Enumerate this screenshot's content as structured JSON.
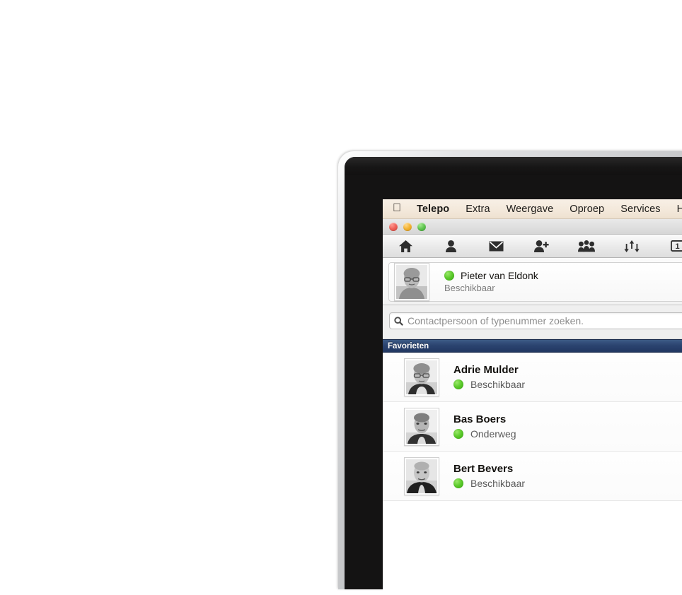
{
  "menubar": {
    "apple_icon": "apple-logo-icon",
    "items": [
      {
        "label": "Telepo",
        "bold": true
      },
      {
        "label": "Extra",
        "bold": false
      },
      {
        "label": "Weergave",
        "bold": false
      },
      {
        "label": "Oproep",
        "bold": false
      },
      {
        "label": "Services",
        "bold": false
      },
      {
        "label": "H",
        "bold": false
      }
    ]
  },
  "window": {
    "traffic_lights": [
      {
        "name": "close-button",
        "color": "#ee5f57"
      },
      {
        "name": "minimize-button",
        "color": "#f2b231"
      },
      {
        "name": "zoom-button",
        "color": "#5fc44f"
      }
    ]
  },
  "toolbar": {
    "buttons": [
      {
        "name": "home-icon",
        "label": "Home"
      },
      {
        "name": "person-icon",
        "label": "Contactpersoon"
      },
      {
        "name": "envelope-icon",
        "label": "Berichten"
      },
      {
        "name": "person-add-icon",
        "label": "Contactpersoon toevoegen"
      },
      {
        "name": "group-icon",
        "label": "Groepen"
      },
      {
        "name": "transfer-icon",
        "label": "Doorverbinden"
      },
      {
        "name": "numbered-box-icon",
        "label": "1"
      }
    ]
  },
  "me": {
    "name": "Pieter van Eldonk",
    "status": "Beschikbaar",
    "status_color": "#5fcc2e",
    "avatar_name": "avatar-pieter-van-eldonk"
  },
  "search": {
    "placeholder": "Contactpersoon of typenummer zoeken.",
    "value": "",
    "icon": "search-icon"
  },
  "favorites": {
    "header": "Favorieten",
    "contacts": [
      {
        "name": "Adrie Mulder",
        "status": "Beschikbaar",
        "status_color": "#5fcc2e",
        "avatar_name": "avatar-adrie-mulder"
      },
      {
        "name": "Bas Boers",
        "status": "Onderweg",
        "status_color": "#5fcc2e",
        "avatar_name": "avatar-bas-boers"
      },
      {
        "name": "Bert Bevers",
        "status": "Beschikbaar",
        "status_color": "#5fcc2e",
        "avatar_name": "avatar-bert-bevers"
      }
    ]
  }
}
